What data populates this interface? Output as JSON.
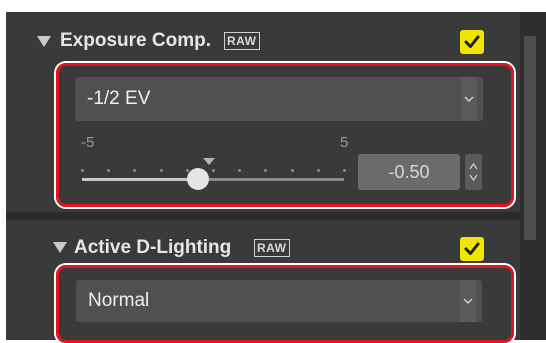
{
  "exposure_comp": {
    "title": "Exposure Comp.",
    "raw_badge": "RAW",
    "enabled": true,
    "dropdown_value": "-1/2 EV",
    "slider_min_label": "-5",
    "slider_max_label": "5",
    "slider_value": -0.5,
    "numeric_value": "-0.50"
  },
  "active_d_lighting": {
    "title": "Active D-Lighting",
    "raw_badge": "RAW",
    "enabled": true,
    "dropdown_value": "Normal"
  },
  "colors": {
    "panel_bg": "#3a3a3a",
    "highlight": "#e0141c",
    "checkbox": "#f2e600"
  },
  "icons": [
    "collapse-triangle-icon",
    "checkmark-icon",
    "chevron-down-icon",
    "stepper-arrows-icon"
  ]
}
